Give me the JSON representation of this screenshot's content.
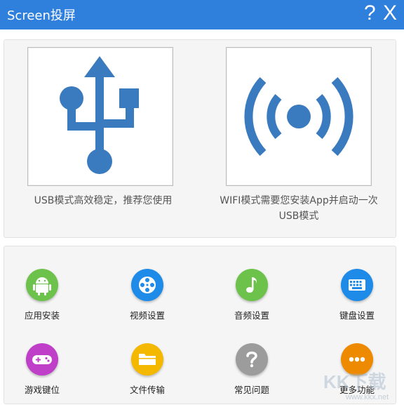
{
  "window": {
    "title": "Screen投屏",
    "help_label": "?",
    "close_label": "X"
  },
  "modes": {
    "usb": {
      "caption": "USB模式高效稳定，推荐您使用",
      "icon": "usb-icon"
    },
    "wifi": {
      "caption": "WIFI模式需要您安装App并启动一次USB模式",
      "icon": "wifi-broadcast-icon"
    }
  },
  "tools": [
    {
      "label": "应用安装",
      "icon": "android-icon",
      "color": "#6cc24a"
    },
    {
      "label": "视频设置",
      "icon": "film-reel-icon",
      "color": "#1e8be8"
    },
    {
      "label": "音频设置",
      "icon": "music-note-icon",
      "color": "#6cc24a"
    },
    {
      "label": "键盘设置",
      "icon": "keyboard-icon",
      "color": "#1e8be8"
    },
    {
      "label": "游戏键位",
      "icon": "gamepad-icon",
      "color": "#c03fc9"
    },
    {
      "label": "文件传输",
      "icon": "folder-icon",
      "color": "#f4b800"
    },
    {
      "label": "常见问题",
      "icon": "question-icon",
      "color": "#9c9c9c"
    },
    {
      "label": "更多功能",
      "icon": "more-dots-icon",
      "color": "#ee8a00"
    }
  ],
  "watermark": {
    "logo": "KK下载",
    "url": "www.kkx.net"
  },
  "colors": {
    "titlebar": "#2f7fdd",
    "icon_blue": "#3a7bbf"
  }
}
